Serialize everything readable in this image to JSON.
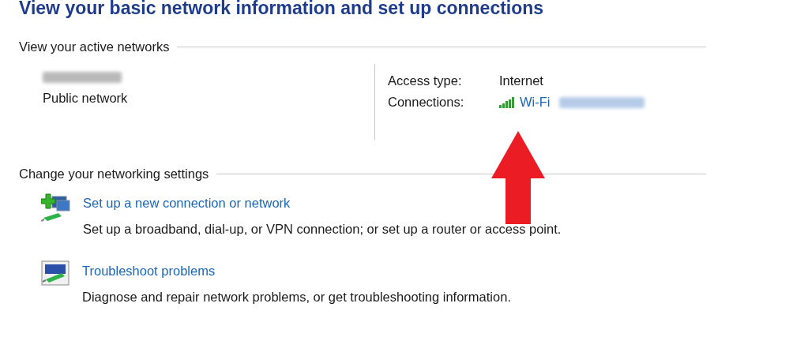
{
  "title": "View your basic network information and set up connections",
  "active_networks": {
    "heading": "View your active networks",
    "network_type": "Public network",
    "access_type_label": "Access type:",
    "access_type": "Internet",
    "connections_label": "Connections:",
    "connection_link": "Wi-Fi"
  },
  "settings": {
    "heading": "Change your networking settings",
    "items": [
      {
        "kind": "new-connection",
        "link": "Set up a new connection or network",
        "description": "Set up a broadband, dial-up, or VPN connection; or set up a router or access point."
      },
      {
        "kind": "troubleshoot",
        "link": "Troubleshoot problems",
        "description": "Diagnose and repair network problems, or get troubleshooting information."
      }
    ]
  }
}
